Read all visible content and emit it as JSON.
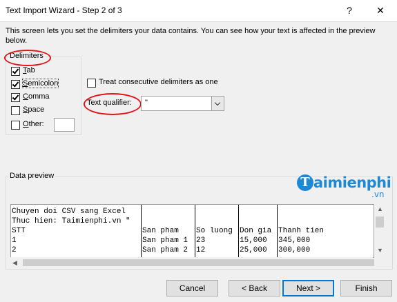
{
  "window": {
    "title": "Text Import Wizard - Step 2 of 3",
    "help_glyph": "?",
    "close_glyph": "✕"
  },
  "intro_text": "This screen lets you set the delimiters your data contains.  You can see how your text is affected in the preview below.",
  "delimiters": {
    "legend": "Delimiters",
    "options": [
      {
        "label": "Tab",
        "accel": "T",
        "rest": "ab",
        "checked": true
      },
      {
        "label": "Semicolon",
        "accel": "S",
        "rest": "emicolon",
        "checked": true
      },
      {
        "label": "Comma",
        "accel": "C",
        "rest": "omma",
        "checked": true
      },
      {
        "label": "Space",
        "accel": "S",
        "rest": "pace",
        "checked": false
      },
      {
        "label": "Other:",
        "accel": "O",
        "rest": "ther:",
        "checked": false
      }
    ],
    "other_value": ""
  },
  "consecutive": {
    "label": "Treat consecutive delimiters as one",
    "accel": "R",
    "checked": false
  },
  "qualifier": {
    "label": "Text qualifier:",
    "value": "\""
  },
  "preview": {
    "legend": "Data preview",
    "logo_text": "aimienphi",
    "logo_initial": "T",
    "logo_suffix": ".vn",
    "lines": [
      [
        "Chuyen doi CSV sang Excel",
        "",
        "",
        "",
        ""
      ],
      [
        "Thuc hien: Taimienphi.vn \"",
        "",
        "",
        "",
        ""
      ],
      [
        "STT",
        "San pham",
        "So luong",
        "Don gia",
        "Thanh tien"
      ],
      [
        "1",
        "San pham 1",
        "23",
        "15,000",
        "345,000"
      ],
      [
        "2",
        "San pham 2",
        "12",
        "25,000",
        "300,000"
      ]
    ]
  },
  "buttons": {
    "cancel": "Cancel",
    "back": "< Back",
    "next": "Next >",
    "finish": "Finish"
  },
  "colors": {
    "highlight": "#e0141b",
    "brand": "#1e88d6",
    "accent": "#0078d7"
  }
}
